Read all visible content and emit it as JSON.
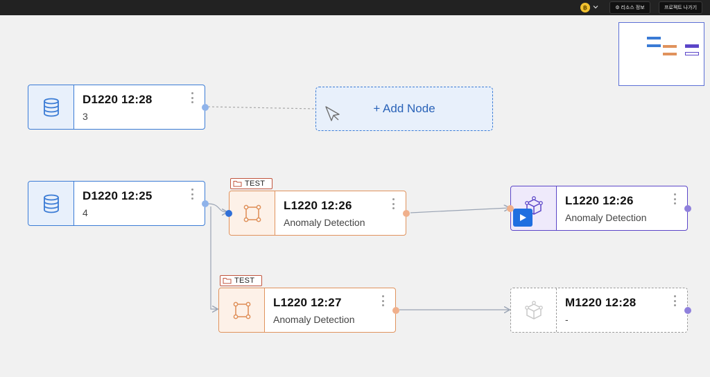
{
  "topbar": {
    "coin_glyph": "฿",
    "resource_button_label": "⚙ 리소스 정보",
    "exit_button_label": "프로젝트 나가기"
  },
  "add_node": {
    "label": "+ Add Node"
  },
  "nodes": [
    {
      "title": "D1220 12:28",
      "subtitle": "3",
      "kind": "data",
      "icon": "database-icon"
    },
    {
      "title": "D1220 12:25",
      "subtitle": "4",
      "kind": "data",
      "icon": "database-icon"
    },
    {
      "title": "L1220 12:26",
      "subtitle": "Anomaly Detection",
      "kind": "learning",
      "icon": "bounding-box-icon",
      "tag": "TEST"
    },
    {
      "title": "L1220 12:27",
      "subtitle": "Anomaly Detection",
      "kind": "learning",
      "icon": "bounding-box-icon",
      "tag": "TEST"
    },
    {
      "title": "L1220 12:26",
      "subtitle": "Anomaly Detection",
      "kind": "learning-run",
      "icon": "model-cube-icon",
      "action": "play-button"
    },
    {
      "title": "M1220 12:28",
      "subtitle": "-",
      "kind": "model-placeholder",
      "icon": "model-cube-icon"
    }
  ],
  "colors": {
    "data": "#3a7bd5",
    "learning": "#e0925c",
    "learning_run": "#5b45c8",
    "tag_border": "#c0533c",
    "model_dashed": "#9a9a9a",
    "play": "#1f6fe0"
  }
}
